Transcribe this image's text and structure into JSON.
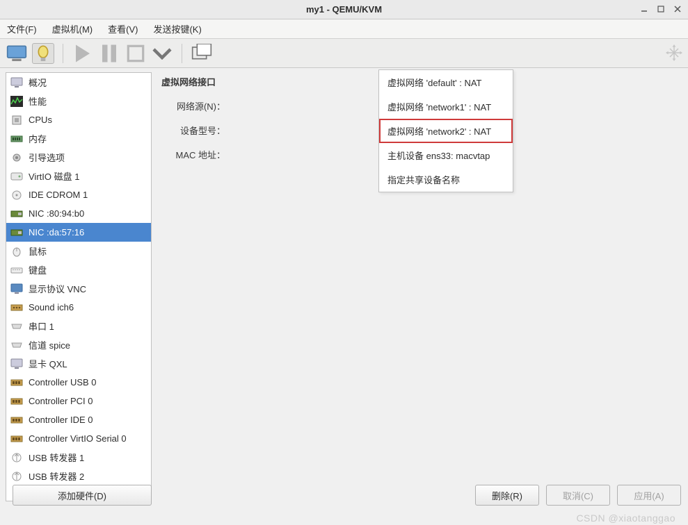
{
  "window": {
    "title": "my1 - QEMU/KVM"
  },
  "menu": {
    "file": "文件(F)",
    "vm": "虚拟机(M)",
    "view": "查看(V)",
    "sendkey": "发送按键(K)"
  },
  "sidebar": {
    "items": [
      {
        "label": "概况"
      },
      {
        "label": "性能"
      },
      {
        "label": "CPUs"
      },
      {
        "label": "内存"
      },
      {
        "label": "引导选项"
      },
      {
        "label": "VirtIO 磁盘 1"
      },
      {
        "label": "IDE CDROM 1"
      },
      {
        "label": "NIC :80:94:b0"
      },
      {
        "label": "NIC :da:57:16"
      },
      {
        "label": "鼠标"
      },
      {
        "label": "键盘"
      },
      {
        "label": "显示协议 VNC"
      },
      {
        "label": "Sound ich6"
      },
      {
        "label": "串口 1"
      },
      {
        "label": "信道 spice"
      },
      {
        "label": "显卡 QXL"
      },
      {
        "label": "Controller USB 0"
      },
      {
        "label": "Controller PCI 0"
      },
      {
        "label": "Controller IDE 0"
      },
      {
        "label": "Controller VirtIO Serial 0"
      },
      {
        "label": "USB 转发器 1"
      },
      {
        "label": "USB 转发器 2"
      }
    ]
  },
  "form": {
    "heading": "虚拟网络接口",
    "network_source_label": "网络源(N)：",
    "device_model_label": "设备型号：",
    "mac_addr_label": "MAC 地址："
  },
  "dropdown": {
    "items": [
      {
        "label": "虚拟网络 'default' : NAT"
      },
      {
        "label": "虚拟网络 'network1' : NAT"
      },
      {
        "label": "虚拟网络 'network2' : NAT"
      },
      {
        "label": "主机设备 ens33: macvtap"
      },
      {
        "label": "指定共享设备名称"
      }
    ]
  },
  "buttons": {
    "add_hw": "添加硬件(D)",
    "remove": "删除(R)",
    "cancel": "取消(C)",
    "apply": "应用(A)"
  },
  "watermark": "CSDN @xiaotanggao"
}
